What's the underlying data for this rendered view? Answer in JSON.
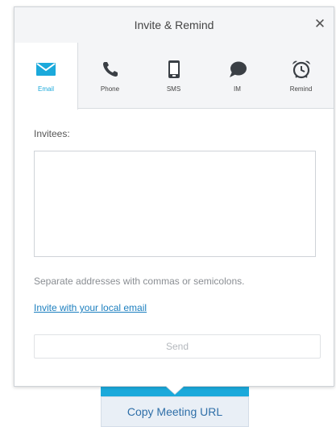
{
  "dialog": {
    "title": "Invite & Remind",
    "close_glyph": "✕"
  },
  "tabs": [
    {
      "label": "Email",
      "icon": "envelope-icon",
      "active": true
    },
    {
      "label": "Phone",
      "icon": "phone-icon",
      "active": false
    },
    {
      "label": "SMS",
      "icon": "mobile-icon",
      "active": false
    },
    {
      "label": "IM",
      "icon": "chat-bubble-icon",
      "active": false
    },
    {
      "label": "Remind",
      "icon": "alarm-clock-icon",
      "active": false
    }
  ],
  "form": {
    "invitees_label": "Invitees:",
    "invitees_value": "",
    "helper_text": "Separate addresses with commas or semicolons.",
    "local_email_link": "Invite with your local email",
    "send_label": "Send"
  },
  "background": {
    "copy_url_label": "Copy Meeting URL"
  },
  "colors": {
    "accent": "#1ba9db",
    "link": "#1c7fbf",
    "header_bg": "#f4f5f7"
  }
}
